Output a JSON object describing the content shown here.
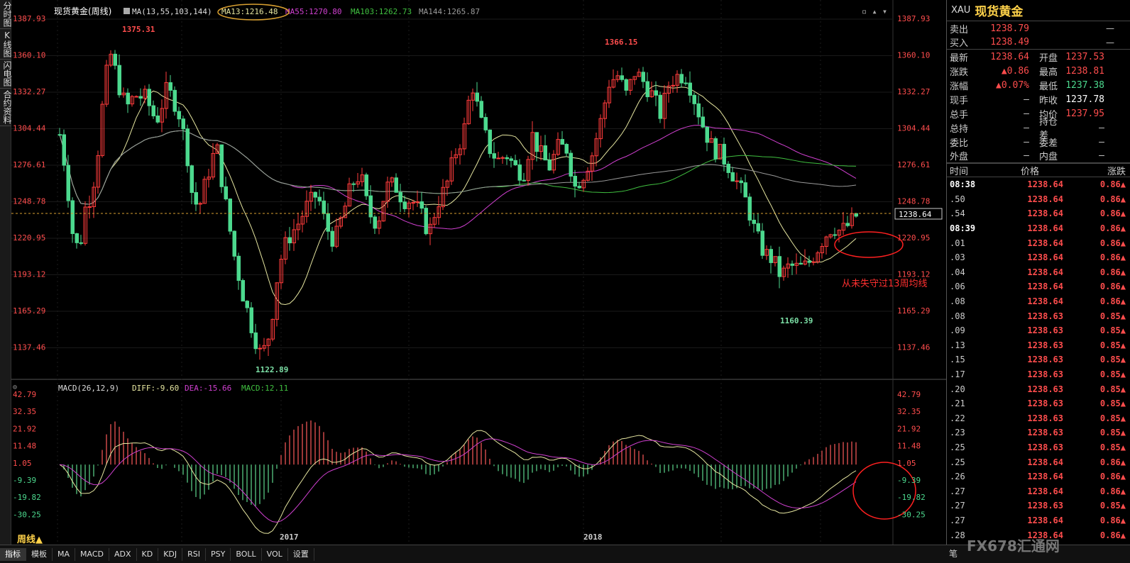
{
  "left_toolbar": [
    "分时图",
    "K线图",
    "闪电图",
    "合约资料"
  ],
  "chart": {
    "title": "现货黄金(周线)",
    "ma_legend": {
      "params": "MA(13,55,103,144)",
      "ma13": "MA13:1216.48",
      "ma55": "MA55:1270.80",
      "ma103": "MA103:1262.73",
      "ma144": "MA144:1265.87"
    },
    "price_axis": [
      "1387.93",
      "1360.10",
      "1332.27",
      "1304.44",
      "1276.61",
      "1248.78",
      "1220.95",
      "1193.12",
      "1165.29",
      "1137.46"
    ],
    "current_price_tag": "1238.64",
    "annotations": {
      "high1": "1375.31",
      "high2": "1366.15",
      "low1": "1122.89",
      "low2": "1160.39",
      "note": "从未失守过13周均线"
    },
    "macd_legend": {
      "params": "MACD(26,12,9)",
      "diff": "DIFF:-9.60",
      "dea": "DEA:-15.66",
      "macd": "MACD:12.11"
    },
    "macd_axis": [
      "42.79",
      "32.35",
      "21.92",
      "11.48",
      "1.05",
      "-9.39",
      "-19.82",
      "-30.25"
    ],
    "x_labels": [
      "2017",
      "2018"
    ],
    "period": "周线▲",
    "colors": {
      "up": "#ff3b3b",
      "down": "#4cd98e",
      "ma13": "#e6e6a0",
      "ma55": "#d040d0",
      "ma103": "#40c040",
      "ma144": "#9a9a9a",
      "axis_text": "#ff4d4d",
      "annotation_circle_ma": "#d9a030",
      "annotation_circle": "#ff2020"
    }
  },
  "bottom_tabs": [
    "指标",
    "模板",
    "MA",
    "MACD",
    "ADX",
    "KD",
    "KDJ",
    "RSI",
    "PSY",
    "BOLL",
    "VOL",
    "设置"
  ],
  "quote": {
    "code": "XAU",
    "name": "现货黄金",
    "sell": {
      "label": "卖出",
      "value": "1238.79",
      "vol": "—"
    },
    "buy": {
      "label": "买入",
      "value": "1238.49",
      "vol": "—"
    },
    "rows": [
      {
        "l1": "最新",
        "v1": "1238.64",
        "l2": "开盘",
        "v2": "1237.53"
      },
      {
        "l1": "涨跌",
        "v1": "▲0.86",
        "l2": "最高",
        "v2": "1238.81"
      },
      {
        "l1": "涨幅",
        "v1": "▲0.07%",
        "l2": "最低",
        "v2": "1237.38"
      },
      {
        "l1": "现手",
        "v1": "—",
        "l2": "昨收",
        "v2": "1237.78"
      },
      {
        "l1": "总手",
        "v1": "—",
        "l2": "均价",
        "v2": "1237.95"
      },
      {
        "l1": "总持",
        "v1": "—",
        "l2": "持仓差",
        "v2": "—"
      },
      {
        "l1": "委比",
        "v1": "—",
        "l2": "委差",
        "v2": "—"
      },
      {
        "l1": "外盘",
        "v1": "—",
        "l2": "内盘",
        "v2": "—"
      }
    ],
    "tick_header": {
      "time": "时间",
      "price": "价格",
      "change": "涨跌"
    },
    "ticks": [
      {
        "t": "08:38",
        "p": "1238.64",
        "c": "0.86▲"
      },
      {
        "t": ".50",
        "p": "1238.64",
        "c": "0.86▲"
      },
      {
        "t": ".54",
        "p": "1238.64",
        "c": "0.86▲"
      },
      {
        "t": "08:39",
        "p": "1238.64",
        "c": "0.86▲"
      },
      {
        "t": ".01",
        "p": "1238.64",
        "c": "0.86▲"
      },
      {
        "t": ".03",
        "p": "1238.64",
        "c": "0.86▲"
      },
      {
        "t": ".04",
        "p": "1238.64",
        "c": "0.86▲"
      },
      {
        "t": ".06",
        "p": "1238.64",
        "c": "0.86▲"
      },
      {
        "t": ".08",
        "p": "1238.64",
        "c": "0.86▲"
      },
      {
        "t": ".08",
        "p": "1238.63",
        "c": "0.85▲"
      },
      {
        "t": ".09",
        "p": "1238.63",
        "c": "0.85▲"
      },
      {
        "t": ".13",
        "p": "1238.63",
        "c": "0.85▲"
      },
      {
        "t": ".15",
        "p": "1238.63",
        "c": "0.85▲"
      },
      {
        "t": ".17",
        "p": "1238.63",
        "c": "0.85▲"
      },
      {
        "t": ".20",
        "p": "1238.63",
        "c": "0.85▲"
      },
      {
        "t": ".21",
        "p": "1238.63",
        "c": "0.85▲"
      },
      {
        "t": ".22",
        "p": "1238.63",
        "c": "0.85▲"
      },
      {
        "t": ".23",
        "p": "1238.63",
        "c": "0.85▲"
      },
      {
        "t": ".25",
        "p": "1238.63",
        "c": "0.85▲"
      },
      {
        "t": ".25",
        "p": "1238.64",
        "c": "0.86▲"
      },
      {
        "t": ".26",
        "p": "1238.64",
        "c": "0.86▲"
      },
      {
        "t": ".27",
        "p": "1238.64",
        "c": "0.86▲"
      },
      {
        "t": ".27",
        "p": "1238.63",
        "c": "0.85▲"
      },
      {
        "t": ".27",
        "p": "1238.64",
        "c": "0.86▲"
      },
      {
        "t": ".28",
        "p": "1238.64",
        "c": "0.86▲"
      }
    ],
    "footer": "笔"
  },
  "watermark": "FX678汇通网"
}
